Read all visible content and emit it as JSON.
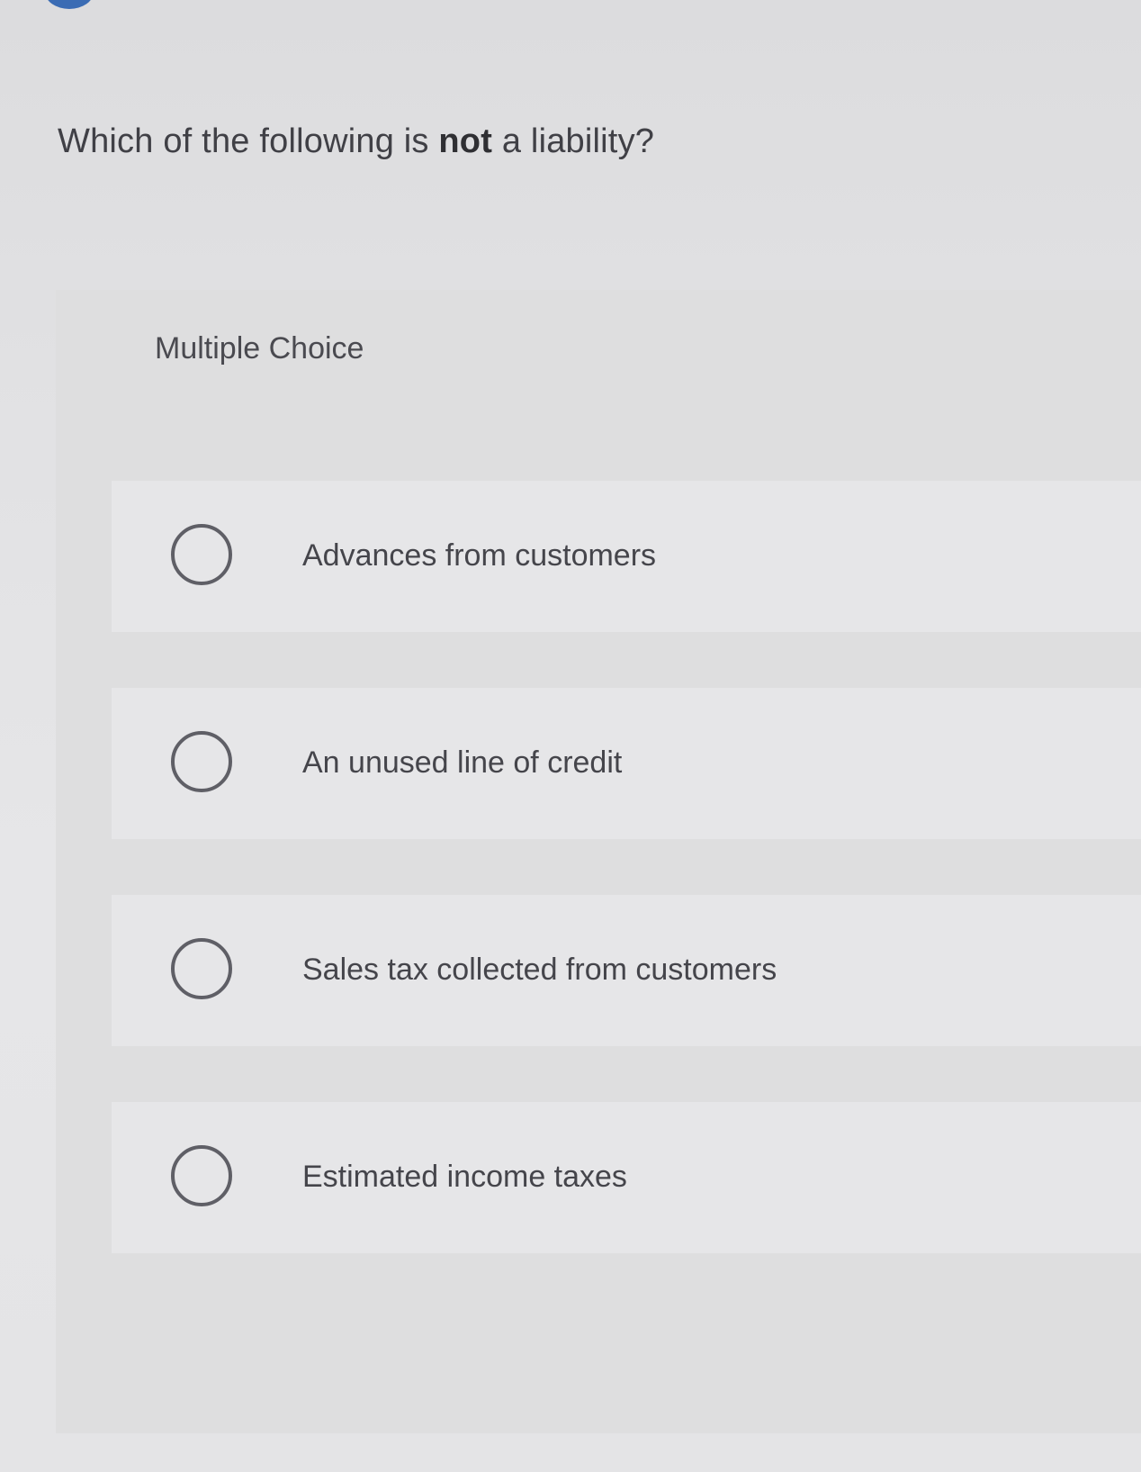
{
  "question": {
    "prefix": "Which of the following is ",
    "emphasis": "not",
    "suffix": " a liability?"
  },
  "panel": {
    "label": "Multiple Choice"
  },
  "options": [
    {
      "label": "Advances from customers",
      "selected": false
    },
    {
      "label": "An unused line of credit",
      "selected": false
    },
    {
      "label": "Sales tax collected from customers",
      "selected": false
    },
    {
      "label": "Estimated income taxes",
      "selected": false
    }
  ],
  "colors": {
    "badge": "#3b6cb4",
    "text": "#404046",
    "radio_border": "#5f5f66"
  }
}
